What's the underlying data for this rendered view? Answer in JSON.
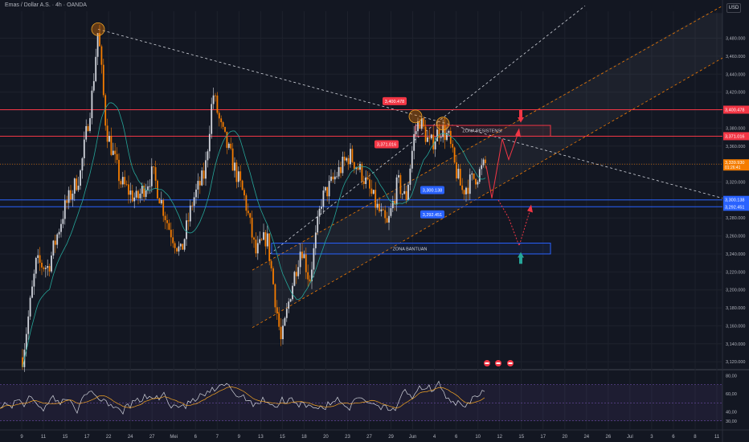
{
  "header": {
    "symbol": "Emas / Dollar A.S.",
    "interval": "4h",
    "broker": "OANDA",
    "currency": "USD"
  },
  "chart_data": [
    {
      "type": "candlestick",
      "title": "Emas / Dollar A.S. · 4h · OANDA",
      "y_axis": {
        "ticks": [
          3480,
          3460,
          3440,
          3420,
          3400,
          3380,
          3360,
          3340,
          3320,
          3300,
          3280,
          3260,
          3240,
          3220,
          3200,
          3180,
          3160,
          3140,
          3120
        ],
        "tick_labels": [
          "3,480.000",
          "3,460.000",
          "3,440.000",
          "3,420.000",
          "3,400.000",
          "3,380.000",
          "3,360.000",
          "3,340.000",
          "3,320.000",
          "3,300.000",
          "3,280.000",
          "3,260.000",
          "3,240.000",
          "3,220.000",
          "3,200.000",
          "3,180.000",
          "3,160.000",
          "3,140.000",
          "3,120.000"
        ],
        "range": [
          3113,
          3510
        ]
      },
      "x_axis": {
        "tick_labels": [
          "9",
          "11",
          "15",
          "17",
          "22",
          "24",
          "27",
          "Mei",
          "6",
          "7",
          "9",
          "13",
          "15",
          "18",
          "20",
          "23",
          "27",
          "29",
          "Jun",
          "4",
          "6",
          "10",
          "12",
          "15",
          "17",
          "20",
          "24",
          "26",
          "Jul",
          "3",
          "6",
          "8",
          "11"
        ]
      },
      "horizontal_lines": [
        {
          "label": "3,400.478",
          "value": 3400.478,
          "color": "#f23645"
        },
        {
          "label": "3,371.016",
          "value": 3371.016,
          "color": "#f23645"
        },
        {
          "label": "3,300.138",
          "value": 3300.138,
          "color": "#2962ff"
        },
        {
          "label": "3,292.451",
          "value": 3292.451,
          "color": "#2962ff"
        }
      ],
      "zones": [
        {
          "label": "ZONA RESISTENSI",
          "from": 3371,
          "to": 3383,
          "color": "#f23645"
        },
        {
          "label": "ZONA BANTUAN",
          "from": 3240,
          "to": 3252,
          "color": "#2962ff"
        }
      ],
      "last_price": {
        "label": "3,339.930",
        "countdown": "01:26:41",
        "color": "#f57c00"
      },
      "axis_level_labels": [
        {
          "text": "3,400.478",
          "color": "#f23645"
        },
        {
          "text": "3,371.016",
          "color": "#f23645"
        },
        {
          "text": "3,300.138",
          "color": "#2962ff"
        },
        {
          "text": "3,292.451",
          "color": "#2962ff"
        }
      ],
      "colors": {
        "up": "#d1d4dc",
        "down": "#f57c00",
        "ma": "#26a69a",
        "background": "#131722"
      }
    },
    {
      "type": "line",
      "title": "",
      "y_axis": {
        "ticks": [
          80,
          60,
          40,
          30
        ],
        "tick_labels": [
          "80,00",
          "60,00",
          "40,00",
          "30,00"
        ],
        "range": [
          28,
          84
        ]
      },
      "bands": [
        70,
        50,
        30
      ],
      "colors": {
        "rsi": "#d1d4dc",
        "signal": "#f5a623",
        "band": "#7e57c2"
      }
    }
  ]
}
